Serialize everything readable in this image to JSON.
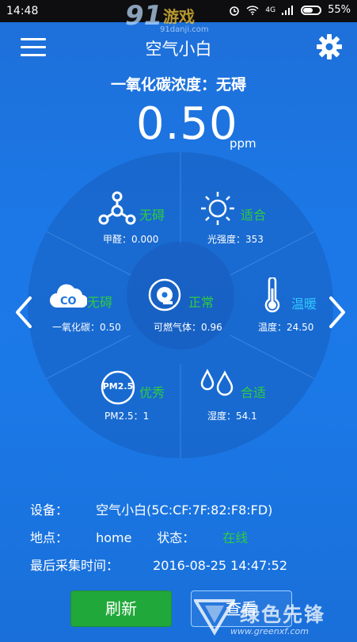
{
  "status_bar": {
    "time": "14:48",
    "network": "4G",
    "battery": "55%"
  },
  "watermark_top": {
    "number": "91",
    "name": "游戏",
    "url": "91danji.com"
  },
  "header": {
    "title": "空气小白"
  },
  "reading": {
    "headline": "一氧化碳浓度：无碍",
    "value": "0.50",
    "unit": "ppm"
  },
  "cells": {
    "formaldehyde": {
      "status": "无碍",
      "label": "甲醛：0.000"
    },
    "light": {
      "status": "适合",
      "label": "光强度：353"
    },
    "co": {
      "status": "无碍",
      "label": "一氧化碳：0.50"
    },
    "gas": {
      "status": "正常",
      "label": "可燃气体：0.96"
    },
    "temperature": {
      "status": "温暖",
      "label": "温度：24.50"
    },
    "pm25": {
      "status": "优秀",
      "label": "PM2.5：1",
      "icon_text": "PM2.5"
    },
    "humidity": {
      "status": "合适",
      "label": "湿度：54.1"
    }
  },
  "info": {
    "device_key": "设备：",
    "device_value": "空气小白(5C:CF:7F:82:F8:FD)",
    "location_key": "地点：",
    "location_value": "home",
    "state_key": "状态：",
    "state_value": "在线",
    "time_key": "最后采集时间：",
    "time_value": "2016-08-25 14:47:52"
  },
  "buttons": {
    "refresh": "刷新",
    "view": "查看"
  },
  "watermark_bottom": {
    "name": "绿色先锋",
    "url": "www.greenxf.com"
  },
  "colors": {
    "good": "#2ecc40",
    "warm": "#32c8ff",
    "background": "#1b79e7"
  }
}
